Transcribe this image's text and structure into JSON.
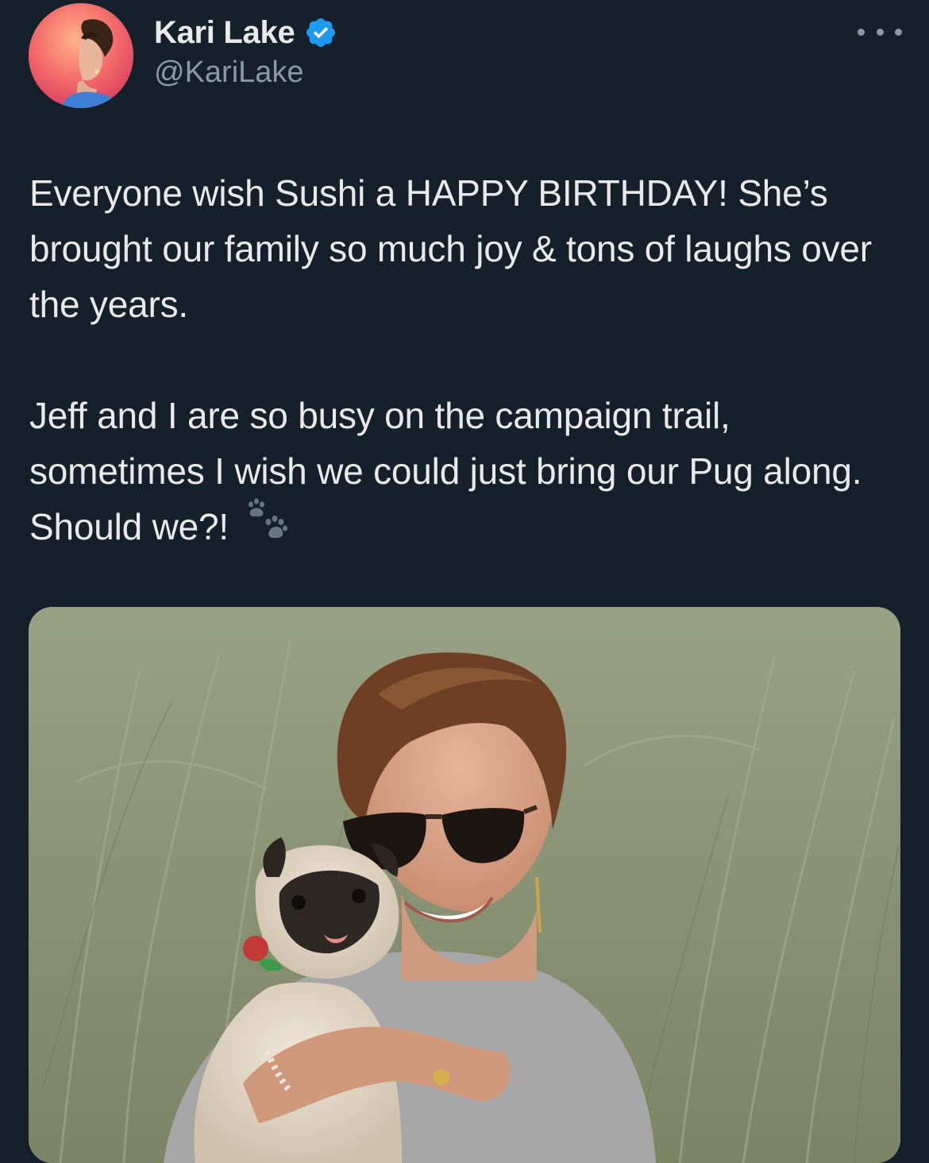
{
  "author": {
    "display_name": "Kari Lake",
    "handle": "@KariLake",
    "verified": true,
    "avatar_icon": "profile-photo",
    "verified_icon": "verified-badge-icon"
  },
  "menu": {
    "icon": "more-options-icon"
  },
  "tweet": {
    "paragraphs": [
      "Everyone wish Sushi a HAPPY BIRTHDAY! She’s brought our family so much joy & tons of laughs over the years.",
      "Jeff and I are so busy on the campaign trail, sometimes I wish we could just bring our Pug along. Should we?!"
    ],
    "emoji": "paw-prints-icon"
  },
  "media": {
    "icon": "photo-woman-holding-pug"
  },
  "colors": {
    "background": "#15202b",
    "text": "#e7e9ea",
    "secondary_text": "#8b98a5",
    "verified_blue": "#1d9bf0"
  }
}
